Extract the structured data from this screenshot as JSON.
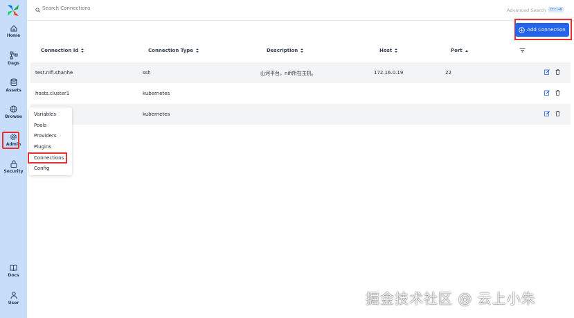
{
  "sidebar": {
    "items": [
      {
        "label": "Home",
        "icon": "home-icon"
      },
      {
        "label": "Dags",
        "icon": "dags-icon"
      },
      {
        "label": "Assets",
        "icon": "assets-icon"
      },
      {
        "label": "Browse",
        "icon": "browse-icon"
      },
      {
        "label": "Admin",
        "icon": "gear-icon"
      },
      {
        "label": "Security",
        "icon": "lock-icon"
      }
    ],
    "bottom_items": [
      {
        "label": "Docs",
        "icon": "book-icon"
      },
      {
        "label": "User",
        "icon": "user-icon"
      }
    ]
  },
  "search": {
    "placeholder": "Search Connections",
    "advanced_label": "Advanced Search",
    "shortcut": "Ctrl+K"
  },
  "toolbar": {
    "add_label": "Add Connection"
  },
  "table": {
    "columns": [
      "Connection Id",
      "Connection Type",
      "Description",
      "Host",
      "Port"
    ],
    "rows": [
      {
        "id": "test.nifi.shanhe",
        "type": "ssh",
        "description": "山河平台，nifi所在主机。",
        "host": "172.16.0.19",
        "port": "22"
      },
      {
        "id": "hosts.cluster1",
        "type": "kubernetes",
        "description": "",
        "host": "",
        "port": ""
      },
      {
        "id": "",
        "type": "kubernetes",
        "description": "",
        "host": "",
        "port": ""
      }
    ]
  },
  "admin_menu": {
    "items": [
      "Variables",
      "Pools",
      "Providers",
      "Plugins",
      "Connections",
      "Config"
    ]
  },
  "watermark": "掘金技术社区 @ 云上小朱",
  "colors": {
    "sidebar_bg": "#c8ddf9",
    "accent": "#2563eb",
    "highlight": "#e03131"
  }
}
